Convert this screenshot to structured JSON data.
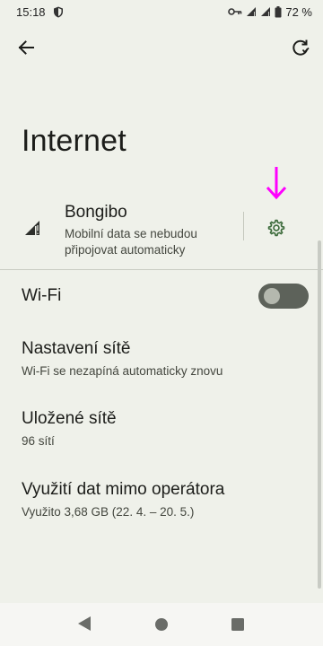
{
  "status_bar": {
    "time": "15:18",
    "battery": "72 %",
    "icons": [
      "shield-icon",
      "vpn-key-icon",
      "signal-icon",
      "signal-icon",
      "battery-icon"
    ]
  },
  "toolbar": {
    "back_icon": "arrow-back-icon",
    "reset_icon": "reset-icon"
  },
  "page": {
    "title": "Internet"
  },
  "mobile_network": {
    "name": "Bongibo",
    "subtitle": "Mobilní data se nebudou připojovat automaticky",
    "settings_icon": "gear-icon",
    "annotation_color": "#ff00ff"
  },
  "wifi": {
    "label": "Wi-Fi",
    "enabled": false
  },
  "items": [
    {
      "title": "Nastavení sítě",
      "subtitle": "Wi-Fi se nezapíná automaticky znovu"
    },
    {
      "title": "Uložené sítě",
      "subtitle": "96 sítí"
    },
    {
      "title": "Využití dat mimo operátora",
      "subtitle": "Využito 3,68 GB (22. 4. – 20. 5.)"
    }
  ],
  "nav_bar": {
    "icons": [
      "nav-back-icon",
      "nav-home-icon",
      "nav-recents-icon"
    ]
  },
  "colors": {
    "background": "#eff1ea",
    "accent": "#3b6a3a",
    "annotation": "#ff00ff"
  }
}
